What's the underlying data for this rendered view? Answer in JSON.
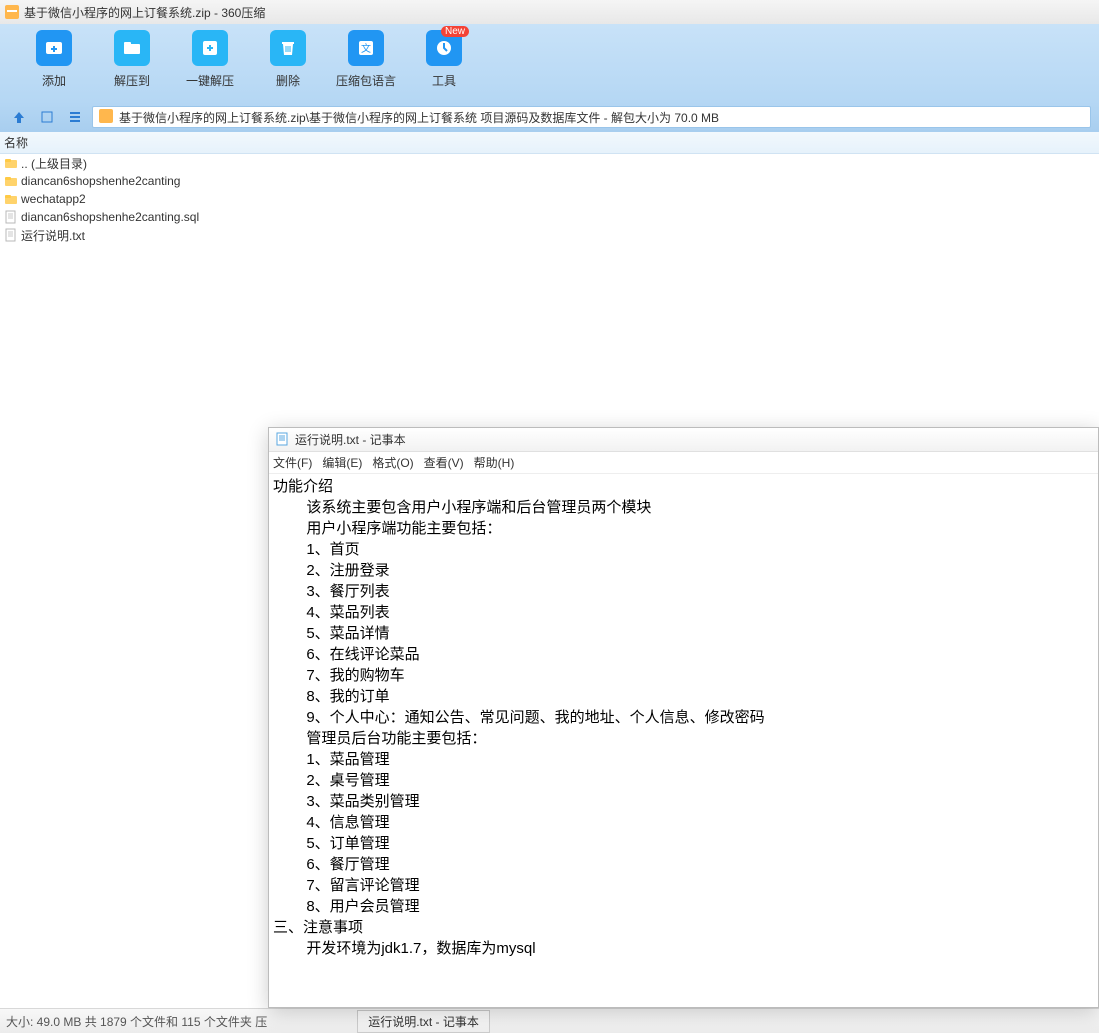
{
  "window_title": "基于微信小程序的网上订餐系统.zip - 360压缩",
  "toolbar": {
    "add": "添加",
    "extract": "解压到",
    "oneclick": "一键解压",
    "delete": "删除",
    "lang": "压缩包语言",
    "tools": "工具",
    "badge": "New"
  },
  "path": "基于微信小程序的网上订餐系统.zip\\基于微信小程序的网上订餐系统 项目源码及数据库文件 - 解包大小为 70.0 MB",
  "col_name": "名称",
  "files": [
    {
      "name": ".. (上级目录)",
      "type": "folder"
    },
    {
      "name": "diancan6shopshenhe2canting",
      "type": "folder"
    },
    {
      "name": "wechatapp2",
      "type": "folder"
    },
    {
      "name": "diancan6shopshenhe2canting.sql",
      "type": "file"
    },
    {
      "name": "运行说明.txt",
      "type": "file"
    }
  ],
  "status": "大小: 49.0 MB 共 1879 个文件和 115 个文件夹 压",
  "taskbar_btn": "运行说明.txt - 记事本",
  "notepad": {
    "title": "运行说明.txt - 记事本",
    "menu": {
      "file": "文件(F)",
      "edit": "编辑(E)",
      "format": "格式(O)",
      "view": "查看(V)",
      "help": "帮助(H)"
    },
    "body": "功能介绍\n        该系统主要包含用户小程序端和后台管理员两个模块\n        用户小程序端功能主要包括：\n        1、首页\n        2、注册登录\n        3、餐厅列表\n        4、菜品列表\n        5、菜品详情\n        6、在线评论菜品\n        7、我的购物车\n        8、我的订单\n        9、个人中心：通知公告、常见问题、我的地址、个人信息、修改密码\n        管理员后台功能主要包括：\n        1、菜品管理\n        2、桌号管理\n        3、菜品类别管理\n        4、信息管理\n        5、订单管理\n        6、餐厅管理\n        7、留言评论管理\n        8、用户会员管理\n三、注意事项\n        开发环境为jdk1.7，数据库为mysql"
  }
}
